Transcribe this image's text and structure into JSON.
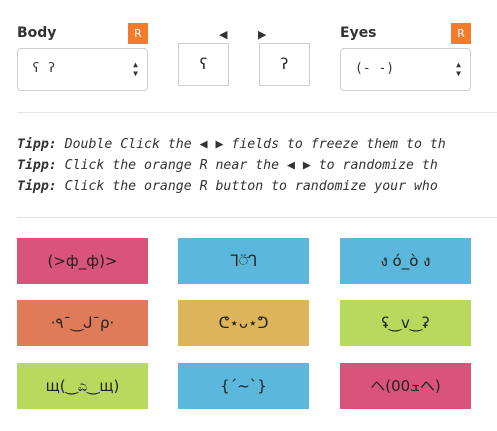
{
  "body": {
    "label": "Body",
    "random_label": "R",
    "selected": "ʕ ʔ"
  },
  "eyes": {
    "label": "Eyes",
    "random_label": "R",
    "selected": "(- -)"
  },
  "parts": {
    "left_arrow": "◀",
    "right_arrow": "▶",
    "left_value": "ʕ",
    "right_value": "ʔ"
  },
  "tips": [
    {
      "prefix": "Tipp:",
      "text": " Double Click the ◀ ▶ fields to freeze them to th"
    },
    {
      "prefix": "Tipp:",
      "text": " Click the orange R near the ◀ ▶ to randomize th"
    },
    {
      "prefix": "Tipp:",
      "text": " Click the orange R button to randomize your who"
    }
  ],
  "faces": [
    {
      "text": "(>ф_ф)>",
      "color": "#d9537a"
    },
    {
      "text": "ᒣ⍥̃ᒉ",
      "color": "#5bb8dc"
    },
    {
      "text": "ง ó_ò ง",
      "color": "#5bb8dc"
    },
    {
      "text": "·٩¯‿ᒍ¯ρ·",
      "color": "#e07b5a"
    },
    {
      "text": "ᕦ⋆ᴗ⋆ᕤ",
      "color": "#dcb55a"
    },
    {
      "text": "ʢ‿v‿ʡ",
      "color": "#b9d85e"
    },
    {
      "text": "щ(‿ಎ‿щ)",
      "color": "#b9d85e"
    },
    {
      "text": "{´~`}",
      "color": "#5bb8dc"
    },
    {
      "text": "ヘ(0ܫ0ヘ)",
      "color": "#d9537a"
    }
  ]
}
